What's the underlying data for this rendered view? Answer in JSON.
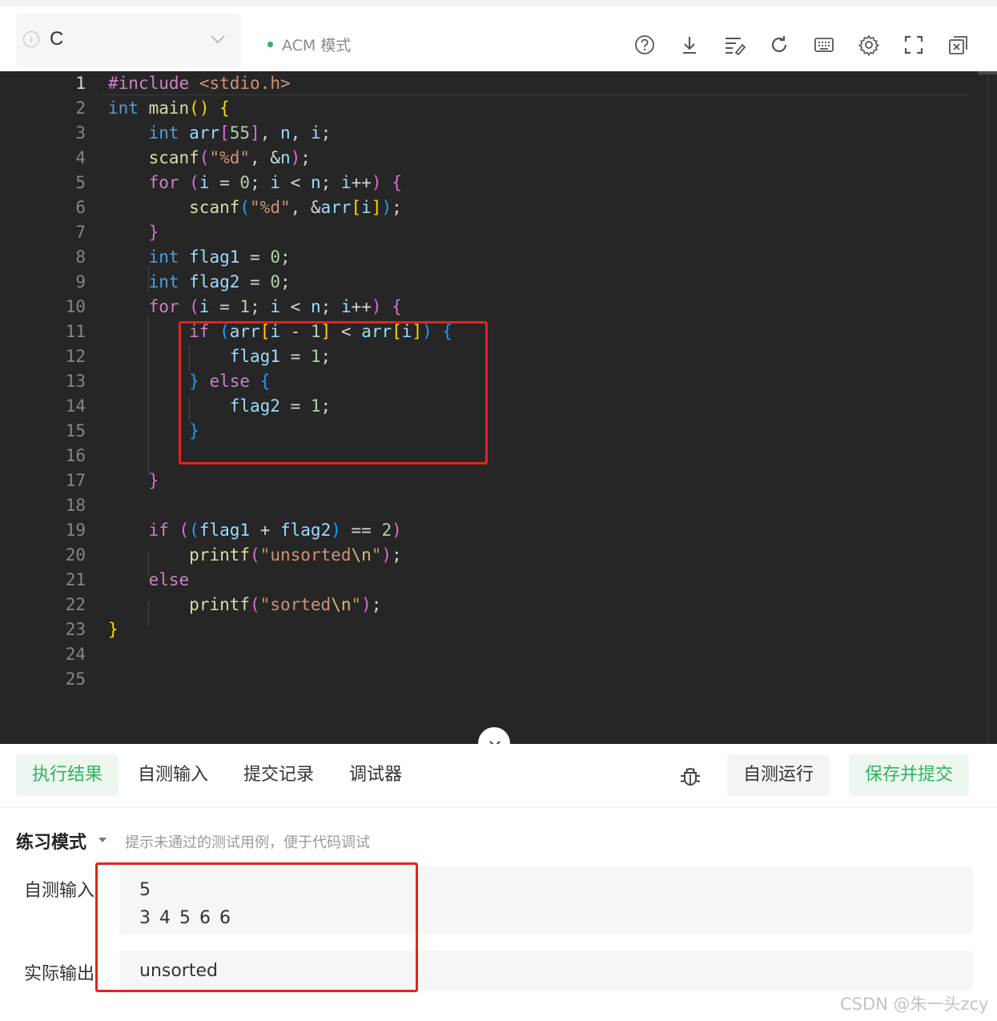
{
  "toolbar": {
    "language": "C",
    "mode": "ACM 模式",
    "icons": [
      "help-icon",
      "download-icon",
      "format-icon",
      "reset-icon",
      "keyboard-icon",
      "settings-icon",
      "fullscreen-icon",
      "close-panel-icon"
    ],
    "accent_color": "#2db55d"
  },
  "editor": {
    "line_numbers": [
      "1",
      "2",
      "3",
      "4",
      "5",
      "6",
      "7",
      "8",
      "9",
      "10",
      "11",
      "12",
      "13",
      "14",
      "15",
      "16",
      "17",
      "18",
      "19",
      "20",
      "21",
      "22",
      "23",
      "24",
      "25"
    ],
    "lines": [
      "#include <stdio.h>",
      "int main() {",
      "    int arr[55], n, i;",
      "    scanf(\"%d\", &n);",
      "    for (i = 0; i < n; i++) {",
      "        scanf(\"%d\", &arr[i]);",
      "    }",
      "    int flag1 = 0;",
      "    int flag2 = 0;",
      "    for (i = 1; i < n; i++) {",
      "        if (arr[i - 1] < arr[i]) {",
      "            flag1 = 1;",
      "        } else {",
      "            flag2 = 1;",
      "        }",
      "",
      "    }",
      "",
      "    if ((flag1 + flag2) == 2)",
      "        printf(\"unsorted\\n\");",
      "    else",
      "        printf(\"sorted\\n\");",
      "}",
      "",
      ""
    ],
    "background_color": "#262626",
    "annotation_color": "#e4231c"
  },
  "panel": {
    "tabs": [
      "执行结果",
      "自测输入",
      "提交记录",
      "调试器"
    ],
    "run_button": "自测运行",
    "submit_button": "保存并提交",
    "practice_mode": "练习模式",
    "practice_hint": "提示未通过的测试用例，便于代码调试",
    "input_label": "自测输入",
    "input_lines": [
      "5",
      "3 4 5 6 6"
    ],
    "output_label": "实际输出",
    "output_value": "unsorted"
  },
  "watermark": "CSDN @朱一头zcy"
}
